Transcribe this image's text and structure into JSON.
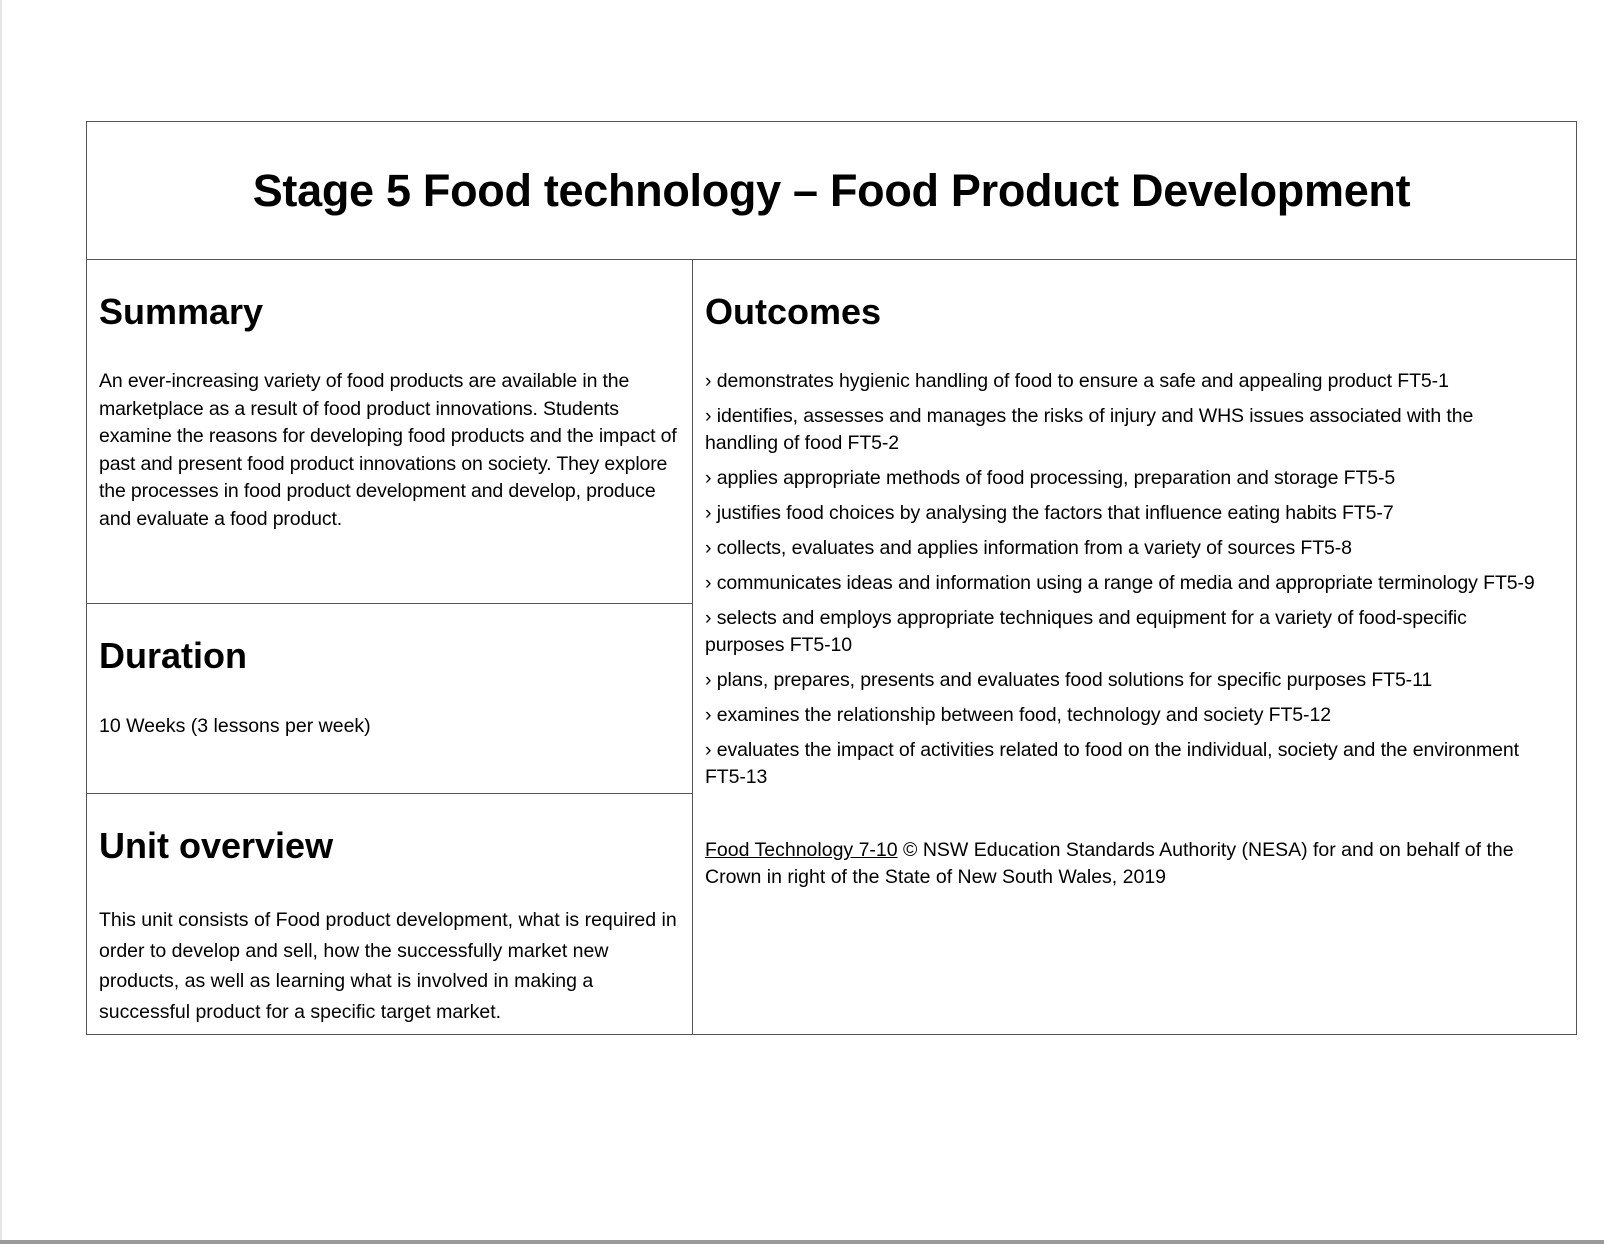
{
  "document": {
    "title": "Stage 5 Food technology – Food Product Development"
  },
  "summary": {
    "heading": "Summary",
    "text": "An ever-increasing variety of food products are available in the marketplace as a result of food product innovations. Students examine the reasons for developing food products and the impact of past and present food product innovations on society. They explore the processes in food product development and develop, produce and evaluate a food product."
  },
  "duration": {
    "heading": "Duration",
    "text": "10 Weeks (3 lessons per week)"
  },
  "unit_overview": {
    "heading": "Unit overview",
    "text": "This unit consists of Food product development, what is required in order to develop and sell, how the successfully market new products, as well as learning what is involved in making a successful product for a specific target market."
  },
  "outcomes": {
    "heading": "Outcomes",
    "items": [
      "› demonstrates hygienic handling of food to ensure a safe and appealing product FT5-1",
      "› identifies, assesses and manages the risks of injury and WHS issues associated with the handling of food FT5-2",
      "› applies appropriate methods of food processing, preparation and storage FT5-5",
      "› justifies food choices by analysing the factors that influence eating habits FT5-7",
      "› collects, evaluates and applies information from a variety of sources FT5-8",
      "› communicates ideas and information using a range of media and appropriate terminology FT5-9",
      "› selects and employs appropriate techniques and equipment for a variety of food-specific purposes FT5-10",
      "› plans, prepares, presents and evaluates food solutions for specific purposes FT5-11",
      "› examines the relationship between food, technology and society FT5-12",
      "› evaluates the impact of activities related to food on the individual, society and the environment FT5-13"
    ],
    "citation": {
      "link_text": "Food Technology 7-10",
      "text": " © NSW Education Standards Authority (NESA) for and on behalf of the Crown in right of the State of New South Wales, 2019"
    }
  }
}
